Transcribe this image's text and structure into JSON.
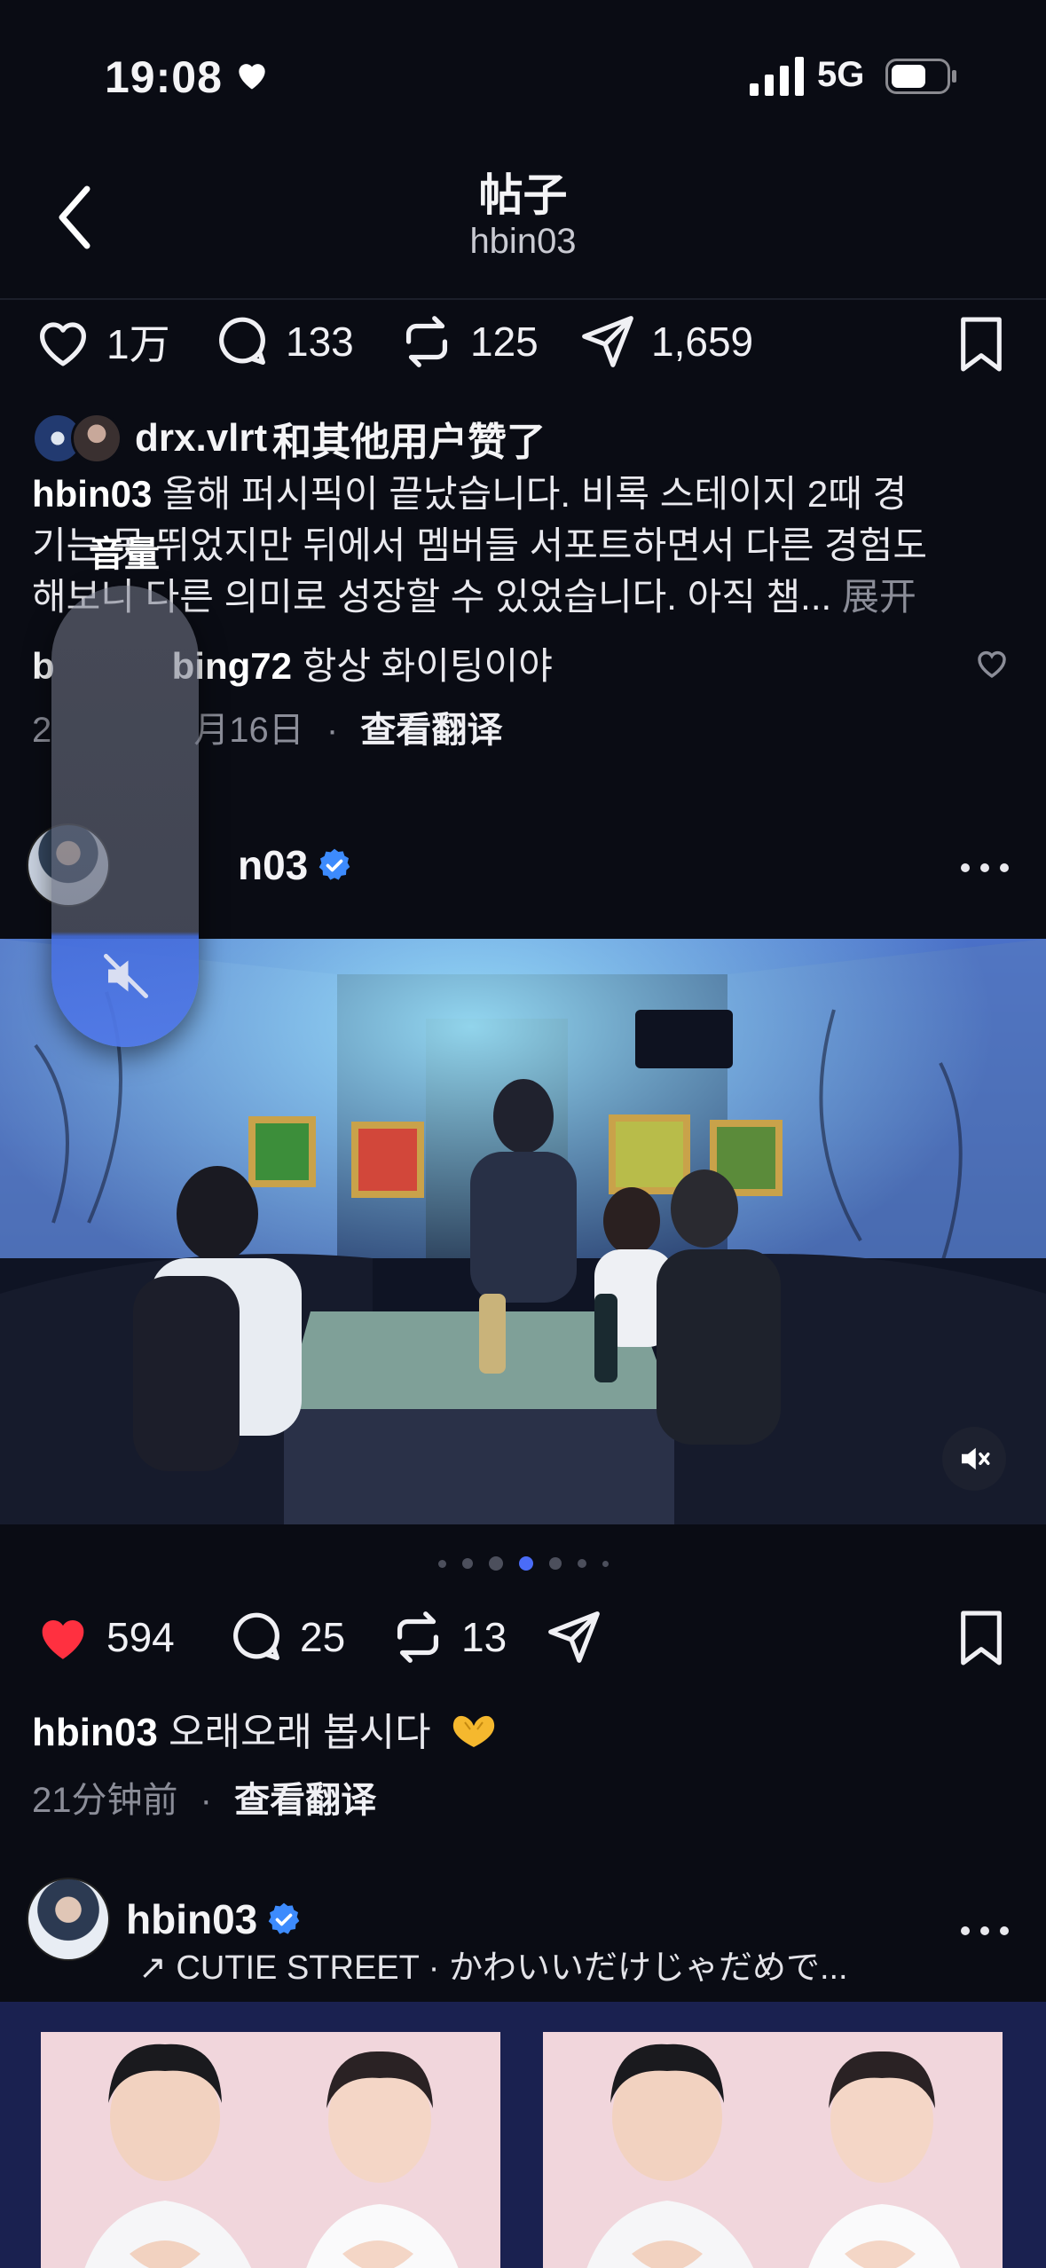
{
  "status": {
    "time": "19:08",
    "network": "5G"
  },
  "header": {
    "title": "帖子",
    "username": "hbin03"
  },
  "top_actions": {
    "likes": "1万",
    "comments": "133",
    "reposts": "125",
    "shares": "1,659"
  },
  "liked": {
    "users": "drx.vlrt",
    "suffix": "和其他用户赞了"
  },
  "post1": {
    "author": "hbin03",
    "line1": "올해 퍼시픽이 끝났습니다. 비록 스테이지 2때 경",
    "line2": "기는 못 뛰었지만 뒤에서 멤버들 서포트하면서 다른 경험도",
    "line3": "해보니 다른 의미로 성장할 수 있었습니다. 아직 챔...",
    "expand": "展开",
    "reply_user": "b",
    "reply_user_tail": "bing72",
    "reply_text": "항상 화이팅이야",
    "date_head": "2",
    "date_tail": "月16日",
    "translate": "查看翻译"
  },
  "volume": {
    "label": "音量"
  },
  "post2": {
    "author": "hbin03",
    "author_visible_tail": "n03",
    "likes": "594",
    "comments": "25",
    "reposts": "13",
    "caption_user": "hbin03",
    "caption_text": "오래오래 봅시다",
    "time": "21分钟前",
    "translate": "查看翻译",
    "carousel": {
      "count": 6,
      "active": 3
    }
  },
  "post3": {
    "author": "hbin03",
    "music": "↗ CUTIE STREET · かわいいだけじゃだめで..."
  },
  "colors": {
    "like_red": "#ff3040",
    "verified_blue": "#3d8bfd",
    "accent_blue": "#4a6cf7"
  }
}
